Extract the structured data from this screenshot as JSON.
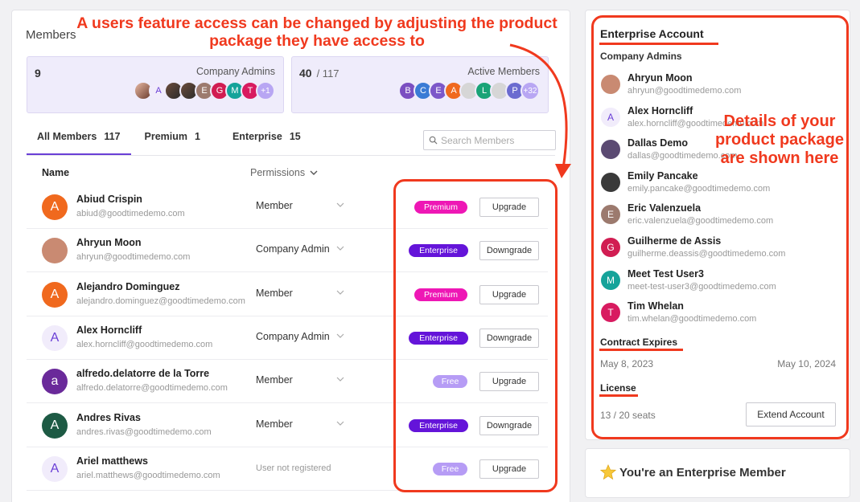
{
  "annotations": {
    "top_note": "A users feature access can be changed by adjusting the product package they have access to",
    "side_note": "Details of your product package are shown here"
  },
  "members": {
    "title": "Members",
    "admins_card": {
      "count": "9",
      "label": "Company Admins",
      "avatars": [
        {
          "letter": "",
          "kind": "photo2"
        },
        {
          "letter": "A",
          "kind": "light"
        },
        {
          "letter": "",
          "kind": "photo"
        },
        {
          "letter": "",
          "kind": "photo"
        },
        {
          "letter": "E",
          "color": "#9c7a6e"
        },
        {
          "letter": "G",
          "color": "#d11d52"
        },
        {
          "letter": "M",
          "color": "#15a39a"
        },
        {
          "letter": "T",
          "color": "#d81b60"
        },
        {
          "letter": "+1",
          "kind": "more"
        }
      ]
    },
    "active_card": {
      "count": "40",
      "total": "/ 117",
      "label": "Active Members",
      "avatars": [
        {
          "letter": "B",
          "color": "#7b4fc1"
        },
        {
          "letter": "C",
          "color": "#3a7bd5"
        },
        {
          "letter": "E",
          "color": "#7c57c9"
        },
        {
          "letter": "A",
          "color": "#f0691e"
        },
        {
          "letter": "",
          "kind": "ghost"
        },
        {
          "letter": "L",
          "color": "#19a377"
        },
        {
          "letter": "",
          "kind": "ghost"
        },
        {
          "letter": "P",
          "color": "#6b6bd0"
        },
        {
          "letter": "+32",
          "kind": "more"
        }
      ]
    },
    "tabs": [
      {
        "label": "All Members",
        "count": "117"
      },
      {
        "label": "Premium",
        "count": "1"
      },
      {
        "label": "Enterprise",
        "count": "15"
      }
    ],
    "search_placeholder": "Search Members",
    "columns": {
      "name": "Name",
      "permissions": "Permissions"
    },
    "rows": [
      {
        "name": "Abiud Crispin",
        "email": "abiud@goodtimedemo.com",
        "permission": "Member",
        "plan": "Premium",
        "action": "Upgrade",
        "avatar_letter": "A",
        "avatar_color": "#f0691e"
      },
      {
        "name": "Ahryun Moon",
        "email": "ahryun@goodtimedemo.com",
        "permission": "Company Admin",
        "plan": "Enterprise",
        "action": "Downgrade",
        "avatar_letter": "",
        "avatar_color": "#c98a72"
      },
      {
        "name": "Alejandro Dominguez",
        "email": "alejandro.dominguez@goodtimedemo.com",
        "permission": "Member",
        "plan": "Premium",
        "action": "Upgrade",
        "avatar_letter": "A",
        "avatar_color": "#f0691e"
      },
      {
        "name": "Alex Horncliff",
        "email": "alex.horncliff@goodtimedemo.com",
        "permission": "Company Admin",
        "plan": "Enterprise",
        "action": "Downgrade",
        "avatar_letter": "A",
        "avatar_color": "#f1ecfb"
      },
      {
        "name": "alfredo.delatorre de la Torre",
        "email": "alfredo.delatorre@goodtimedemo.com",
        "permission": "Member",
        "plan": "Free",
        "action": "Upgrade",
        "avatar_letter": "a",
        "avatar_color": "#6a2a9a"
      },
      {
        "name": "Andres Rivas",
        "email": "andres.rivas@goodtimedemo.com",
        "permission": "Member",
        "plan": "Enterprise",
        "action": "Downgrade",
        "avatar_letter": "A",
        "avatar_color": "#1d5a44"
      },
      {
        "name": "Ariel matthews",
        "email": "ariel.matthews@goodtimedemo.com",
        "permission": "User not registered",
        "plan": "Free",
        "action": "Upgrade",
        "avatar_letter": "A",
        "avatar_color": "#f1ecfb"
      }
    ]
  },
  "enterprise": {
    "title": "Enterprise Account",
    "admins_heading": "Company Admins",
    "admins": [
      {
        "name": "Ahryun Moon",
        "email": "ahryun@goodtimedemo.com",
        "letter": "",
        "color": "#c98a72"
      },
      {
        "name": "Alex Horncliff",
        "email": "alex.horncliff@goodtimedemo.com",
        "letter": "A",
        "color": "#f1ecfb"
      },
      {
        "name": "Dallas Demo",
        "email": "dallas@goodtimedemo.com",
        "letter": "",
        "color": "#5b4a72"
      },
      {
        "name": "Emily Pancake",
        "email": "emily.pancake@goodtimedemo.com",
        "letter": "",
        "color": "#3a3a3a"
      },
      {
        "name": "Eric Valenzuela",
        "email": "eric.valenzuela@goodtimedemo.com",
        "letter": "E",
        "color": "#9c7a6e"
      },
      {
        "name": "Guilherme de Assis",
        "email": "guilherme.deassis@goodtimedemo.com",
        "letter": "G",
        "color": "#d11d52"
      },
      {
        "name": "Meet Test User3",
        "email": "meet-test-user3@goodtimedemo.com",
        "letter": "M",
        "color": "#15a39a"
      },
      {
        "name": "Tim Whelan",
        "email": "tim.whelan@goodtimedemo.com",
        "letter": "T",
        "color": "#d81b60"
      }
    ],
    "contract_heading": "Contract Expires",
    "contract_start": "May 8, 2023",
    "contract_end": "May 10, 2024",
    "license_heading": "License",
    "seats": "13 / 20 seats",
    "extend_label": "Extend Account"
  },
  "banner": {
    "text": "You're an Enterprise Member",
    "icon": "star-icon"
  }
}
